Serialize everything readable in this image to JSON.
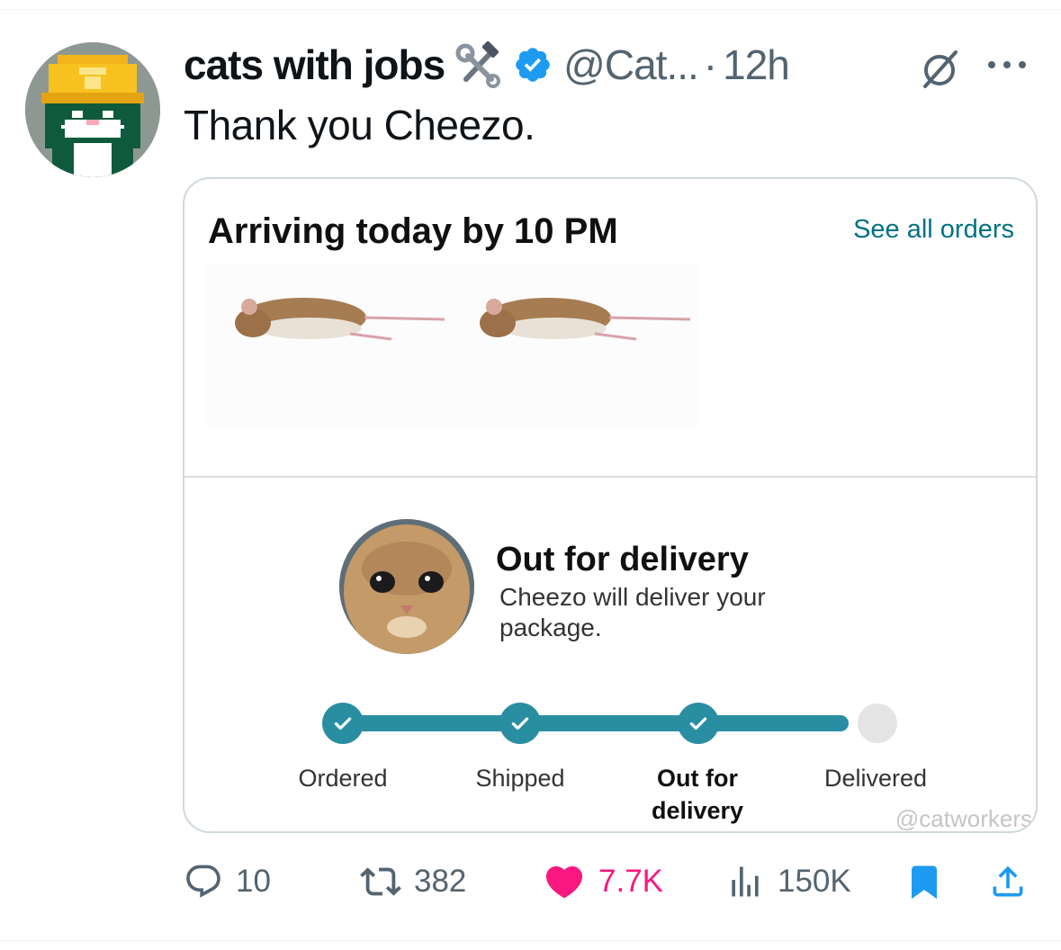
{
  "tweet": {
    "display_name": "cats with jobs",
    "name_emoji": "🛠",
    "handle": "@Cat...",
    "separator": "·",
    "time": "12h",
    "text": "Thank you Cheezo."
  },
  "card": {
    "heading": "Arriving today by 10 PM",
    "see_all_orders": "See all orders",
    "status_title": "Out for delivery",
    "status_subtitle": "Cheezo will deliver your package.",
    "progress_completed_steps": 3,
    "steps": [
      {
        "label": "Ordered",
        "done": true
      },
      {
        "label": "Shipped",
        "done": true
      },
      {
        "label": "Out for delivery",
        "done": true,
        "current": true
      },
      {
        "label": "Delivered",
        "done": false
      }
    ],
    "watermark": "@catworkers"
  },
  "actions": {
    "replies": "10",
    "reposts": "382",
    "likes": "7.7K",
    "views": "150K"
  },
  "icons": [
    "avatar-cat-hardhat",
    "hammer-wrench-icon",
    "verified-badge-icon",
    "grok-icon",
    "more-icon",
    "reply-icon",
    "repost-icon",
    "like-icon",
    "views-icon",
    "bookmark-icon",
    "share-icon"
  ],
  "colors": {
    "verified_blue": "#1d9bf0",
    "like_pink": "#f91880",
    "bookmark_blue": "#1d9bf0",
    "tracker_teal": "#2a8ea3",
    "link_teal": "#007185"
  }
}
